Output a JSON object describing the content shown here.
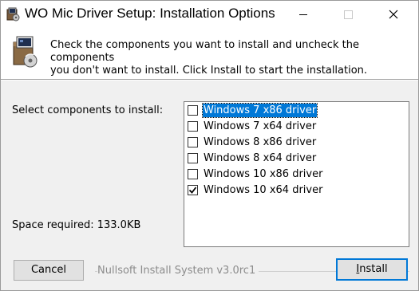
{
  "window": {
    "title": "WO Mic Driver Setup: Installation Options"
  },
  "icons": {
    "app": "installer-app-icon",
    "header": "installer-box-icon",
    "minimize": "minimize-icon",
    "maximize": "maximize-icon",
    "close": "close-icon",
    "checkmark": "checkmark-icon"
  },
  "header": {
    "description_line1": "Check the components you want to install and uncheck the components",
    "description_line2": "you don't want to install. Click Install to start the installation."
  },
  "components": {
    "select_label": "Select components to install:",
    "items": [
      {
        "label": "Windows 7 x86 driver",
        "checked": false,
        "selected": true
      },
      {
        "label": "Windows 7 x64 driver",
        "checked": false,
        "selected": false
      },
      {
        "label": "Windows 8 x86 driver",
        "checked": false,
        "selected": false
      },
      {
        "label": "Windows 8 x64 driver",
        "checked": false,
        "selected": false
      },
      {
        "label": "Windows 10 x86 driver",
        "checked": false,
        "selected": false
      },
      {
        "label": "Windows 10 x64 driver",
        "checked": true,
        "selected": false
      }
    ]
  },
  "space": {
    "label": "Space required: 133.0KB"
  },
  "footer": {
    "branding": "Nullsoft Install System v3.0rc1",
    "cancel_label": "Cancel",
    "install_mnemonic": "I",
    "install_rest": "nstall"
  },
  "colors": {
    "selection": "#0078d7",
    "dialog_background": "#f0f0f0",
    "default_button_border": "#0078d7"
  }
}
